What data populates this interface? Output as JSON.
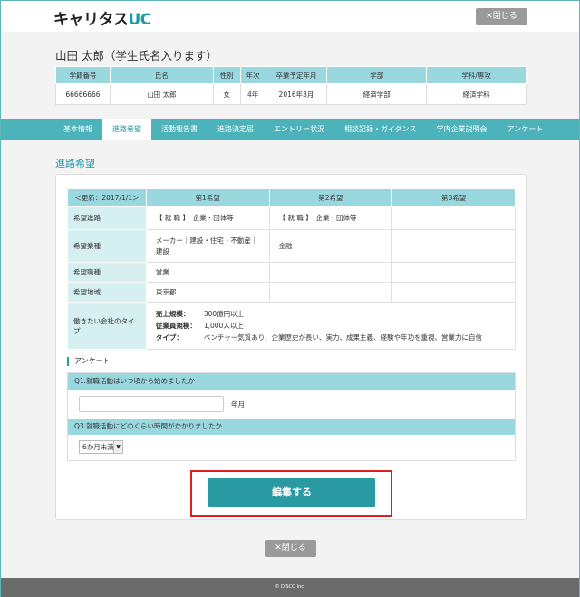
{
  "header": {
    "logo_main": "キャリタス",
    "logo_uc": "UC",
    "close_label": "✕閉じる"
  },
  "student": {
    "name": "山田 太郎（学生氏名入ります）",
    "columns": [
      "学籍番号",
      "氏名",
      "性別",
      "年次",
      "卒業予定年月",
      "学部",
      "学科/専攻"
    ],
    "values": [
      "66666666",
      "山田 太郎",
      "女",
      "4年",
      "2016年3月",
      "経済学部",
      "経済学科"
    ]
  },
  "tabs": [
    {
      "label": "基本情報",
      "active": false
    },
    {
      "label": "進路希望",
      "active": true
    },
    {
      "label": "活動報告書",
      "active": false
    },
    {
      "label": "進路決定届",
      "active": false
    },
    {
      "label": "エントリー状況",
      "active": false
    },
    {
      "label": "相談記録・ガイダンス",
      "active": false
    },
    {
      "label": "学内企業説明会",
      "active": false
    },
    {
      "label": "アンケート",
      "active": false
    }
  ],
  "section_title": "進路希望",
  "prefs": {
    "updated": "＜更新：2017/1/1＞",
    "headers": [
      "第1希望",
      "第2希望",
      "第3希望"
    ],
    "rows": {
      "course": {
        "label": "希望進路",
        "v1": "【 就 職 】　企業・団体等",
        "v2": "【 就 職 】　企業・団体等",
        "v3": ""
      },
      "industry": {
        "label": "希望業種",
        "v1": "メーカー｜建設・住宅・不動産｜建設",
        "v2": "金融",
        "v3": ""
      },
      "job": {
        "label": "希望職種",
        "v1": "営業",
        "v2": "",
        "v3": ""
      },
      "area": {
        "label": "希望地域",
        "v1": "東京都",
        "v2": "",
        "v3": ""
      },
      "company": {
        "label": "働きたい会社のタイプ",
        "sales_key": "売上規模：",
        "sales_val": "300億円以上",
        "emp_key": "従業員規模：",
        "emp_val": "1,000人以上",
        "type_key": "タイプ：",
        "type_val": "ベンチャー気質あり、企業歴史が長い、実力、成果主義、経験や年功を重視、営業力に自信"
      }
    }
  },
  "survey": {
    "title": "アンケート",
    "q1": "Q1.就職活動はいつ頃から始めましたか",
    "q1_value": "",
    "q1_unit": "年月",
    "q3": "Q3.就職活動にどのくらい時間がかかりましたか",
    "q3_selected": "6か月未満"
  },
  "edit_label": "編集する",
  "footer": "© DISCO Inc.",
  "colors": {
    "accent": "#2a9aa2",
    "tab_bar": "#4db3ba",
    "header_cell": "#9ad8df",
    "highlight_border": "#e01c1c"
  }
}
